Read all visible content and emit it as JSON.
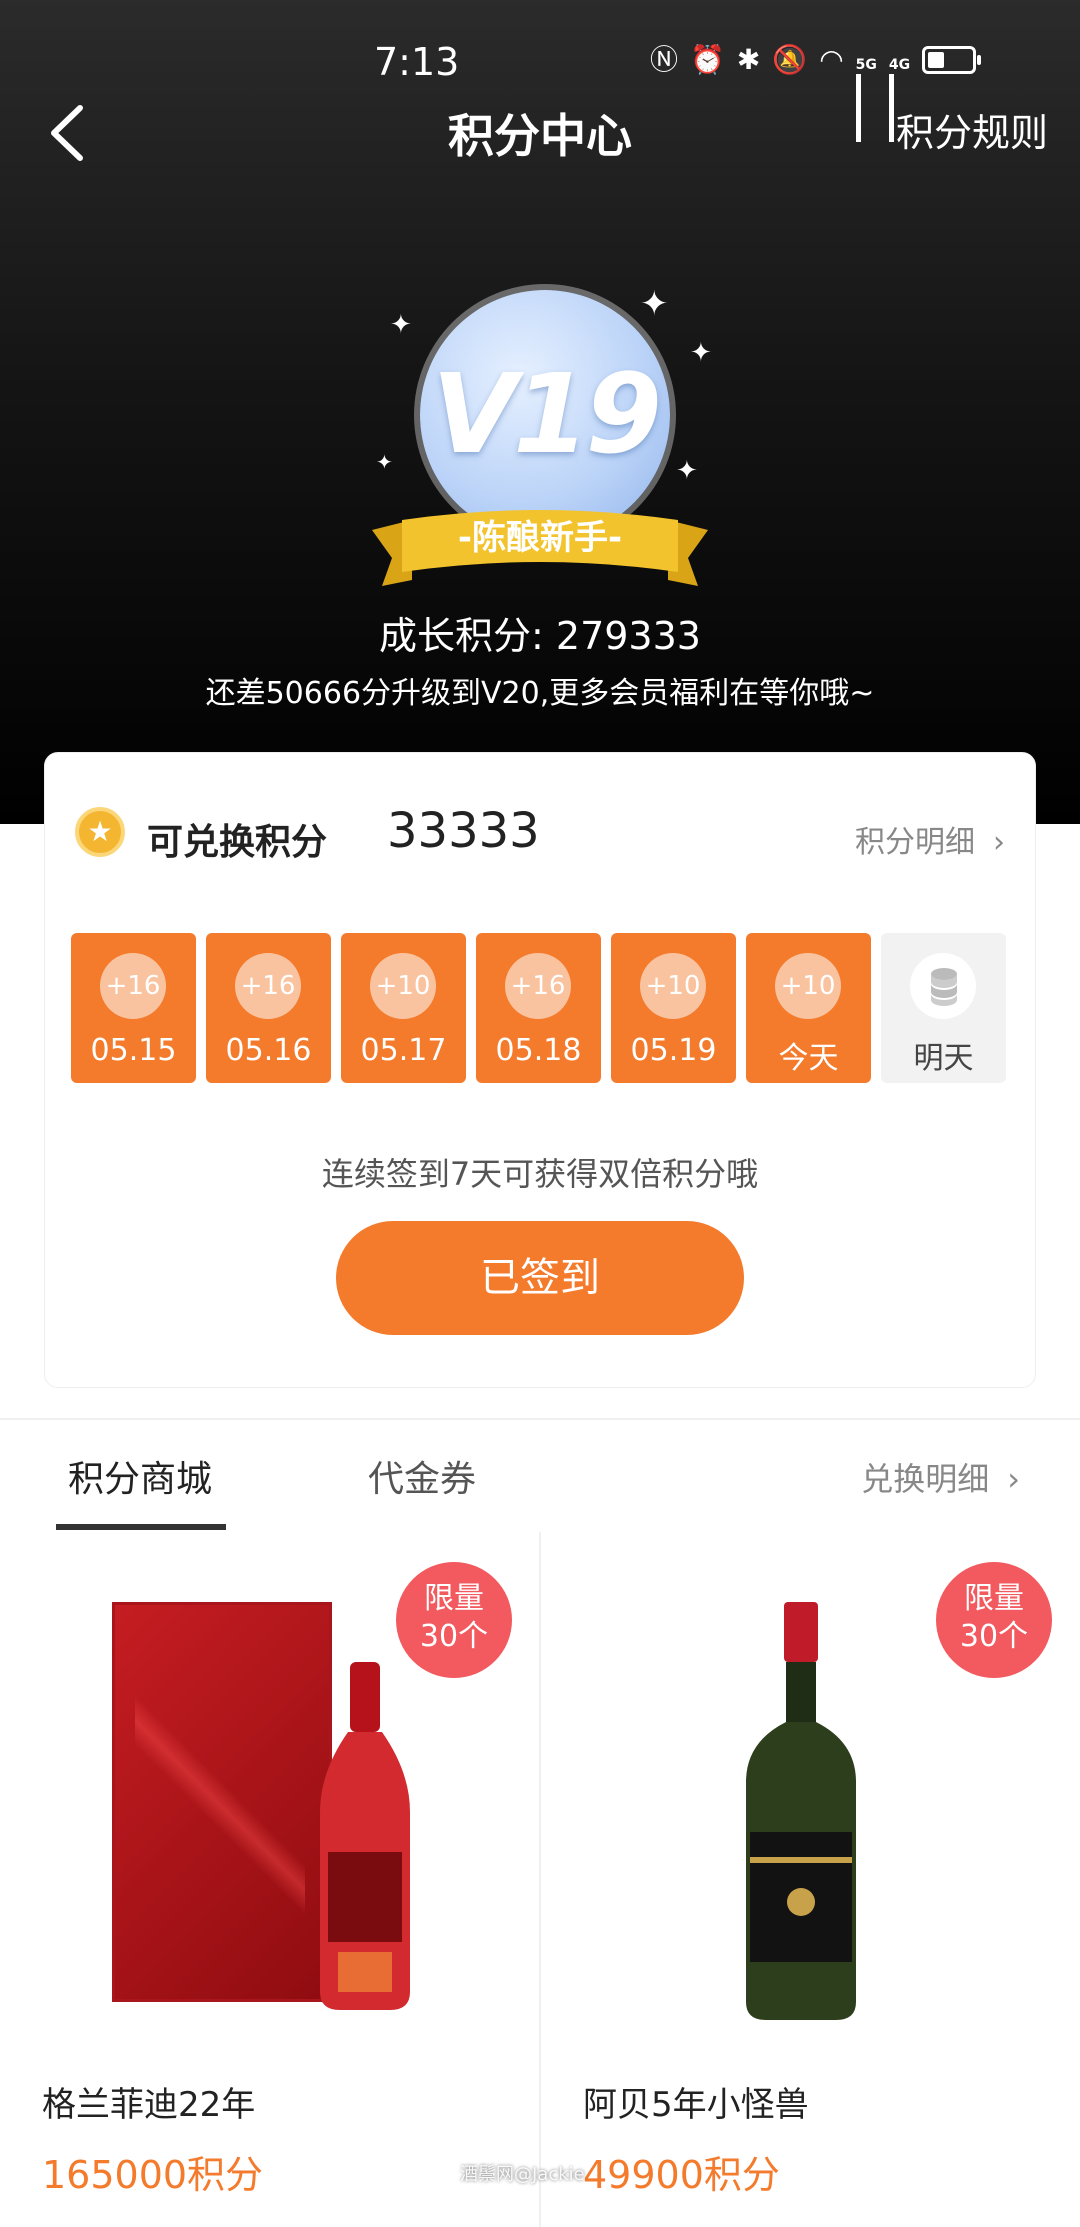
{
  "status_bar": {
    "time": "7:13",
    "net1": "5G",
    "net2": "4G"
  },
  "nav": {
    "title": "积分中心",
    "rules": "积分规则"
  },
  "level": {
    "badge": "V19",
    "rank": "-陈酿新手-"
  },
  "growth": {
    "text": "成长积分: 279333",
    "upgrade": "还差50666分升级到V20,更多会员福利在等你哦~"
  },
  "points": {
    "label": "可兑换积分",
    "value": "33333",
    "detail": "积分明细"
  },
  "checkin": {
    "days": [
      {
        "bonus": "+16",
        "label": "05.15"
      },
      {
        "bonus": "+16",
        "label": "05.16"
      },
      {
        "bonus": "+10",
        "label": "05.17"
      },
      {
        "bonus": "+16",
        "label": "05.18"
      },
      {
        "bonus": "+10",
        "label": "05.19"
      },
      {
        "bonus": "+10",
        "label": "今天"
      }
    ],
    "tomorrow": "明天",
    "streak_tip": "连续签到7天可获得双倍积分哦",
    "button": "已签到"
  },
  "tabs": {
    "mall": "积分商城",
    "coupon": "代金券",
    "exchange": "兑换明细"
  },
  "products": [
    {
      "limit_line1": "限量",
      "limit_line2": "30个",
      "name": "格兰菲迪22年",
      "price": "165000积分"
    },
    {
      "limit_line1": "限量",
      "limit_line2": "30个",
      "name": "阿贝5年小怪兽",
      "price": "49900积分"
    }
  ],
  "watermark": "酒鬃网@Jackie",
  "colors": {
    "accent": "#f47a2c",
    "limit_badge": "#f25a5f",
    "ribbon": "#f2c32c"
  }
}
